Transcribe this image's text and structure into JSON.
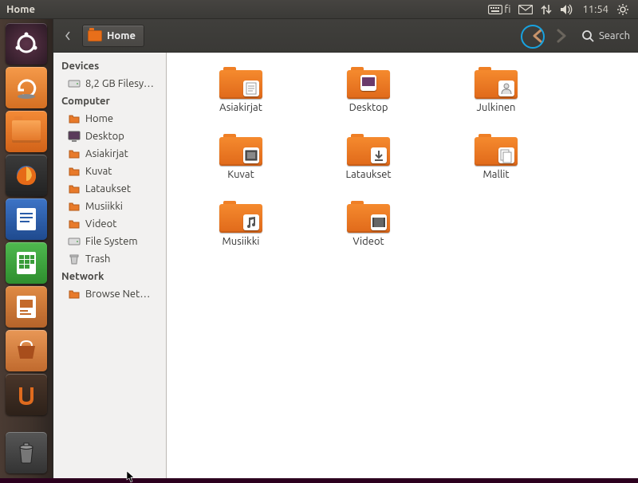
{
  "top_panel": {
    "title": "Home",
    "keyboard_layout": "fi",
    "clock": "11:54",
    "indicators": [
      "keyboard",
      "mail",
      "network",
      "volume",
      "clock",
      "session"
    ]
  },
  "launcher": {
    "items": [
      {
        "name": "dash",
        "color": "#3a2430"
      },
      {
        "name": "update-manager",
        "color": "#e57f33"
      },
      {
        "name": "nautilus",
        "color": "#e57f33"
      },
      {
        "name": "firefox",
        "color": "#2a2a2a"
      },
      {
        "name": "libreoffice-writer",
        "color": "#2559a5"
      },
      {
        "name": "libreoffice-calc",
        "color": "#2e9a2e"
      },
      {
        "name": "libreoffice-impress",
        "color": "#c46a2b"
      },
      {
        "name": "software-center",
        "color": "#d07a3c"
      },
      {
        "name": "ubuntu-one",
        "color": "#37281f"
      }
    ],
    "end": {
      "name": "trash",
      "color": "#3b3b3b"
    }
  },
  "nautilus": {
    "breadcrumb": "Home",
    "search_label": "Search",
    "sidebar": {
      "devices_header": "Devices",
      "devices": [
        {
          "label": "8,2 GB Filesy…",
          "icon": "drive"
        }
      ],
      "computer_header": "Computer",
      "computer": [
        {
          "label": "Home",
          "icon": "folder"
        },
        {
          "label": "Desktop",
          "icon": "desktop"
        },
        {
          "label": "Asiakirjat",
          "icon": "folder"
        },
        {
          "label": "Kuvat",
          "icon": "folder"
        },
        {
          "label": "Lataukset",
          "icon": "folder"
        },
        {
          "label": "Musiikki",
          "icon": "folder"
        },
        {
          "label": "Videot",
          "icon": "folder"
        },
        {
          "label": "File System",
          "icon": "drive"
        },
        {
          "label": "Trash",
          "icon": "trash"
        }
      ],
      "network_header": "Network",
      "network": [
        {
          "label": "Browse Net…",
          "icon": "folder"
        }
      ]
    },
    "folders": [
      {
        "label": "Asiakirjat",
        "badge": "doc"
      },
      {
        "label": "Desktop",
        "badge": "desktop"
      },
      {
        "label": "Julkinen",
        "badge": "public"
      },
      {
        "label": "Kuvat",
        "badge": "pictures"
      },
      {
        "label": "Lataukset",
        "badge": "downloads"
      },
      {
        "label": "Mallit",
        "badge": "templates"
      },
      {
        "label": "Musiikki",
        "badge": "music"
      },
      {
        "label": "Videot",
        "badge": "videos"
      }
    ]
  },
  "highlights": {
    "session_gear": true,
    "back_button": true
  }
}
